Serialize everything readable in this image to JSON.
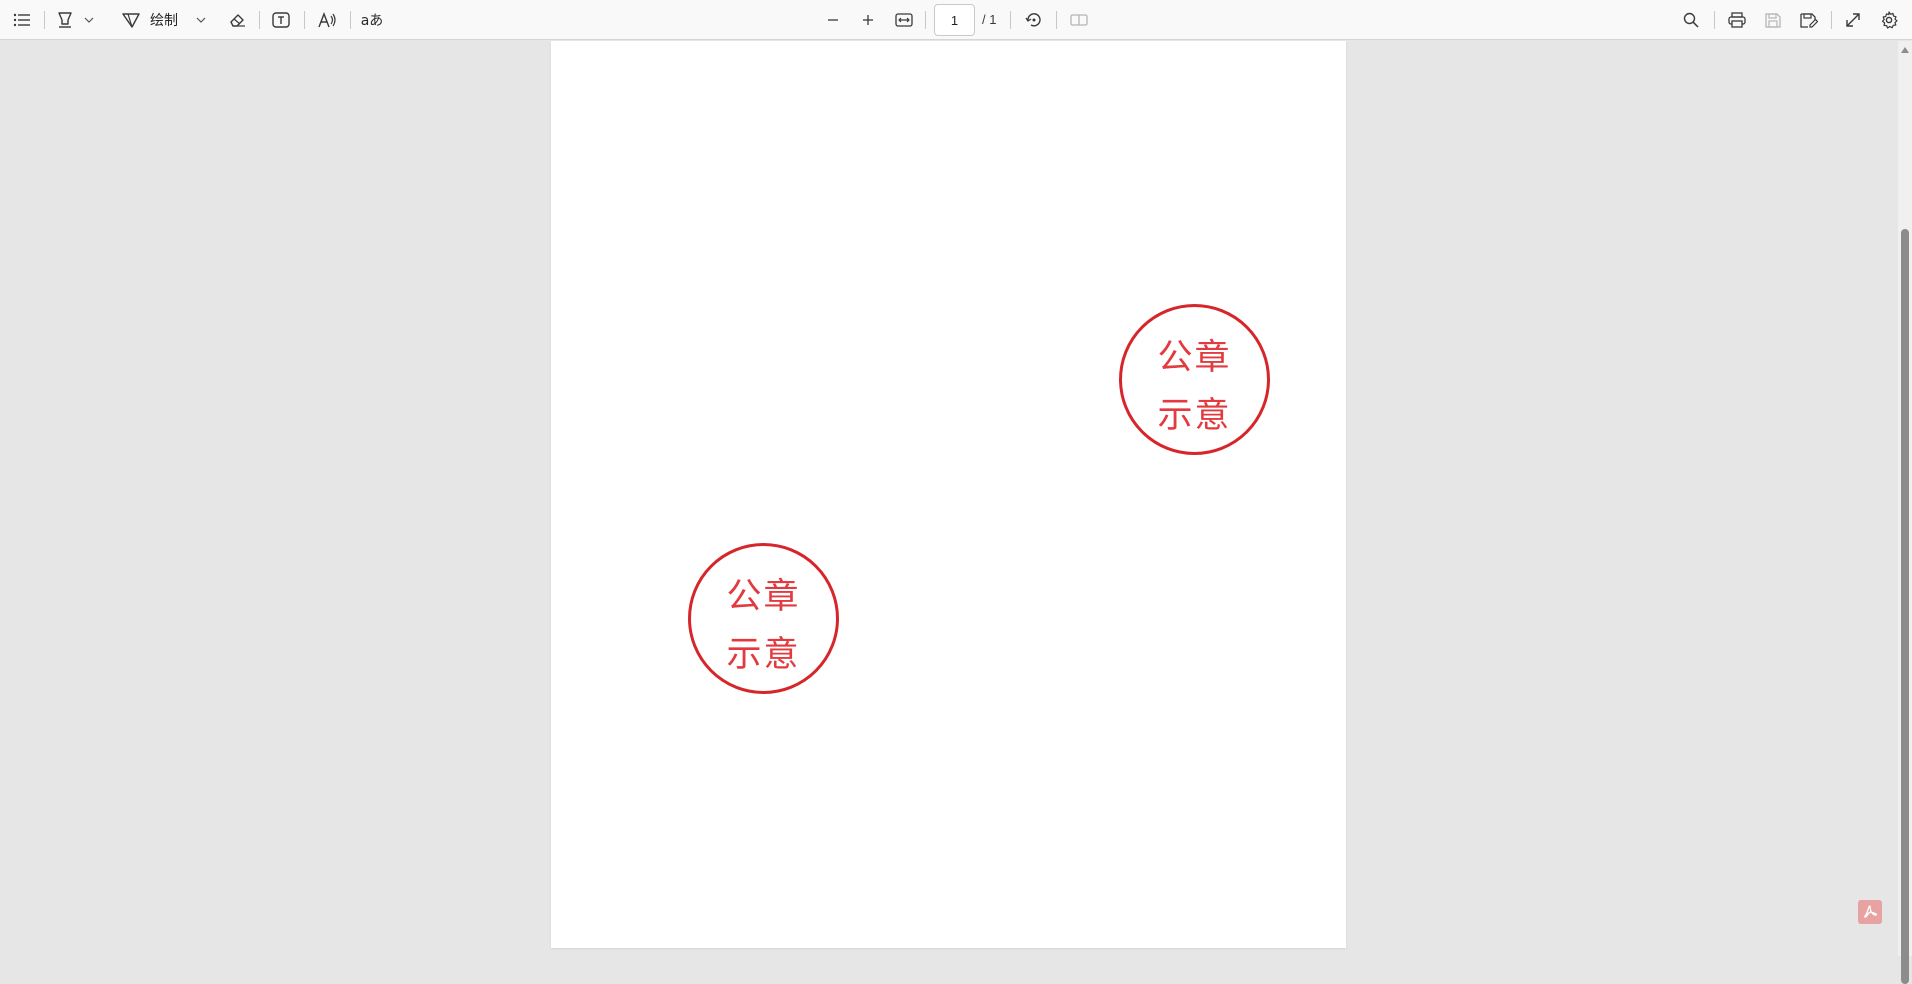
{
  "toolbar": {
    "draw_label": "绘制",
    "page_number": "1",
    "page_total": "/ 1",
    "icons": {
      "toc": "list-icon",
      "highlight": "highlighter-icon",
      "draw": "pen-icon",
      "erase": "eraser-icon",
      "text_box": "text-box-icon",
      "read_aloud": "read-aloud-icon",
      "translate": "translate-icon",
      "zoom_out": "minus-icon",
      "zoom_in": "plus-icon",
      "fit_width": "fit-width-icon",
      "rotate": "rotate-icon",
      "page_view": "page-view-icon",
      "search": "search-icon",
      "print": "print-icon",
      "save": "save-icon",
      "save_as": "save-as-icon",
      "fullscreen": "expand-icon",
      "settings": "gear-icon"
    },
    "translate_text": "aあ",
    "read_aloud_text": "A"
  },
  "document": {
    "seals": [
      {
        "line1": "公章",
        "line2": "示意"
      },
      {
        "line1": "公章",
        "line2": "示意"
      }
    ],
    "seal_color": "#d6262b"
  },
  "badge": {
    "icon": "pdf-icon",
    "color": "#e8a2a2"
  }
}
